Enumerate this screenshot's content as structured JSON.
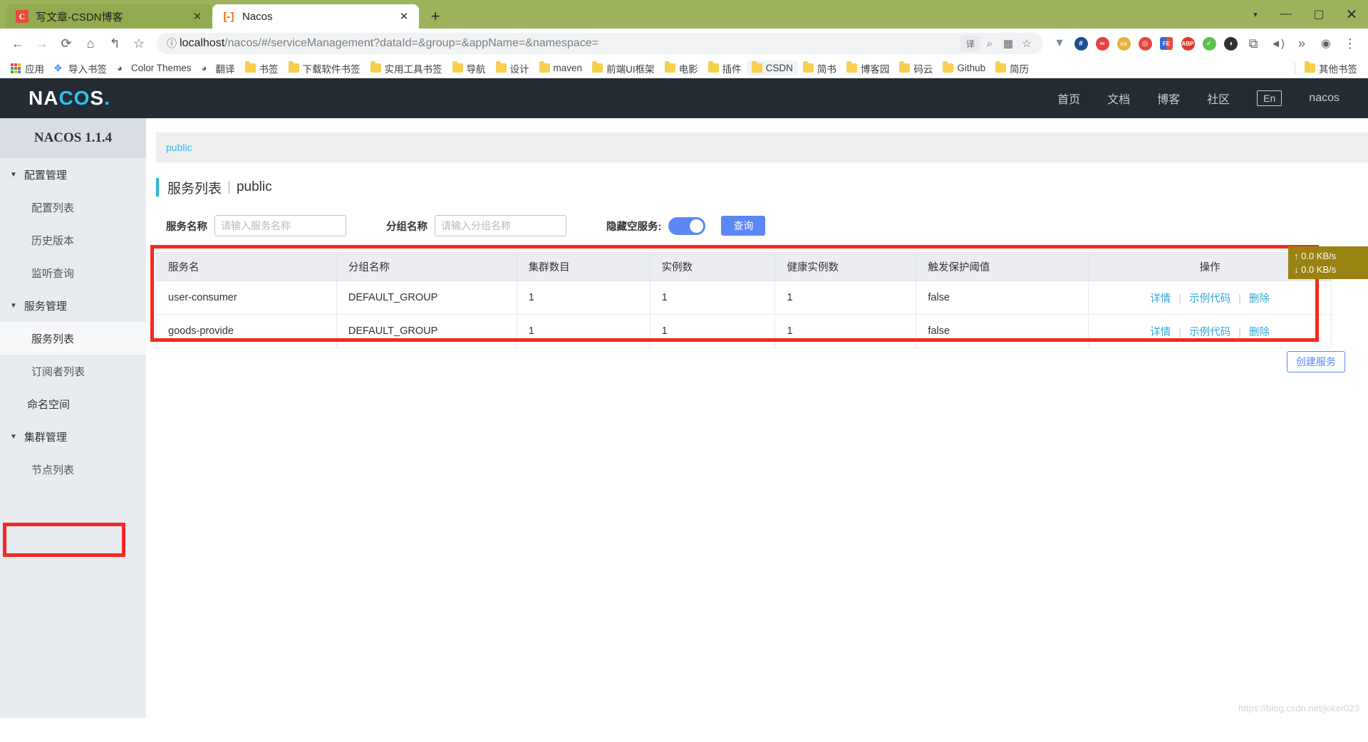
{
  "browser": {
    "tabs": [
      {
        "title": "写文章-CSDN博客",
        "favicon": "csdn-icon",
        "active": false,
        "close": "✕"
      },
      {
        "title": "Nacos",
        "favicon": "nacos-icon",
        "active": true,
        "close": "✕"
      }
    ],
    "new_tab_label": "+",
    "window_controls": {
      "dropdown": "▾",
      "minimize": "—",
      "maximize": "▢",
      "close": "✕"
    },
    "toolbar": {
      "back": "←",
      "forward": "→",
      "reload": "⟳",
      "home": "⌂",
      "undo": "↰",
      "bookmark_star": "☆",
      "info": "ⓘ",
      "url_prefix": "localhost",
      "url_suffix": "/nacos/#/serviceManagement?dataId=&group=&appName=&namespace=",
      "translate": "译",
      "zoom": "⌕",
      "qr": "▦",
      "star": "☆",
      "menu": "⋮",
      "profile": "☻",
      "screenshot": "⧉",
      "mute": "🔇",
      "chevrons": "»"
    },
    "bookmarks": [
      {
        "label": "应用",
        "icon": "apps-icon"
      },
      {
        "label": "导入书签",
        "icon": "import-icon"
      },
      {
        "label": "Color Themes",
        "icon": "theme-icon"
      },
      {
        "label": "翻译",
        "icon": "translate-icon"
      },
      {
        "label": "书签",
        "icon": "folder-icon"
      },
      {
        "label": "下载软件书签",
        "icon": "folder-icon"
      },
      {
        "label": "实用工具书签",
        "icon": "folder-icon"
      },
      {
        "label": "导航",
        "icon": "folder-icon"
      },
      {
        "label": "设计",
        "icon": "folder-icon"
      },
      {
        "label": "maven",
        "icon": "folder-icon"
      },
      {
        "label": "前端UI框架",
        "icon": "folder-icon"
      },
      {
        "label": "电影",
        "icon": "folder-icon"
      },
      {
        "label": "插件",
        "icon": "folder-icon"
      },
      {
        "label": "CSDN",
        "icon": "folder-icon"
      },
      {
        "label": "简书",
        "icon": "folder-icon"
      },
      {
        "label": "博客园",
        "icon": "folder-icon"
      },
      {
        "label": "码云",
        "icon": "folder-icon"
      },
      {
        "label": "Github",
        "icon": "folder-icon"
      },
      {
        "label": "简历",
        "icon": "folder-icon"
      }
    ],
    "other_bookmarks": {
      "label": "其他书签",
      "icon": "folder-icon"
    }
  },
  "nacos": {
    "logo": {
      "part1": "NA",
      "part2": "CO",
      "part3": "S",
      "dot": "."
    },
    "nav": [
      {
        "label": "首页"
      },
      {
        "label": "文档"
      },
      {
        "label": "博客"
      },
      {
        "label": "社区"
      }
    ],
    "lang_badge": "En",
    "user": "nacos"
  },
  "sidebar": {
    "version_title": "NACOS 1.1.4",
    "groups": [
      {
        "label": "配置管理",
        "caret": "▼",
        "items": [
          {
            "label": "配置列表",
            "active": false
          },
          {
            "label": "历史版本",
            "active": false
          },
          {
            "label": "监听查询",
            "active": false
          }
        ]
      },
      {
        "label": "服务管理",
        "caret": "▼",
        "items": [
          {
            "label": "服务列表",
            "active": true
          },
          {
            "label": "订阅者列表",
            "active": false
          }
        ]
      }
    ],
    "namespace_item": {
      "label": "命名空间"
    },
    "cluster_group": {
      "label": "集群管理",
      "caret": "▼",
      "items": [
        {
          "label": "节点列表",
          "active": false
        }
      ]
    }
  },
  "main": {
    "breadcrumb": "public",
    "title": "服务列表",
    "title_sep": "|",
    "title_namespace": "public",
    "search": {
      "service_label": "服务名称",
      "service_placeholder": "请输入服务名称",
      "service_value": "",
      "group_label": "分组名称",
      "group_placeholder": "请输入分组名称",
      "group_value": "",
      "hide_empty_label": "隐藏空服务:",
      "hide_empty_on": true,
      "query_button": "查询",
      "create_button": "创建服务"
    },
    "table": {
      "columns": [
        "服务名",
        "分组名称",
        "集群数目",
        "实例数",
        "健康实例数",
        "触发保护阈值",
        "操作"
      ],
      "rows": [
        {
          "name": "user-consumer",
          "group": "DEFAULT_GROUP",
          "clusters": "1",
          "instances": "1",
          "healthy": "1",
          "threshold": "false",
          "actions": [
            "详情",
            "示例代码",
            "删除"
          ]
        },
        {
          "name": "goods-provide",
          "group": "DEFAULT_GROUP",
          "clusters": "1",
          "instances": "1",
          "healthy": "1",
          "threshold": "false",
          "actions": [
            "详情",
            "示例代码",
            "删除"
          ]
        }
      ],
      "action_separator": "|"
    }
  },
  "overlay": {
    "net_up": "↑ 0.0 KB/s",
    "net_down": "↓ 0.0 KB/s",
    "watermark": "https://blog.csdn.net/joker023"
  },
  "colors": {
    "accent_blue": "#5b87f7",
    "link_blue": "#33a7d8",
    "header_dark": "#252b33",
    "highlight_red": "#f5291f",
    "tabstrip_green": "#9cb35b"
  }
}
